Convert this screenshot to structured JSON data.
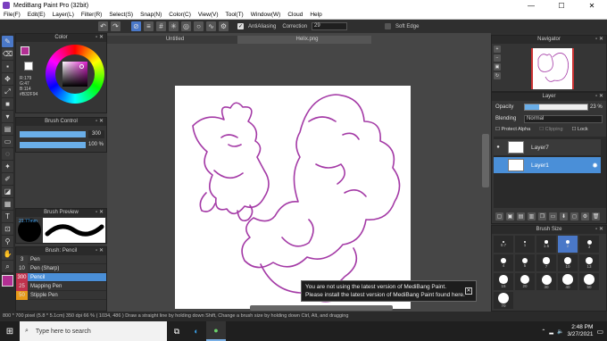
{
  "window": {
    "title": "MediBang Paint Pro (32bit)",
    "minimize": "—",
    "maximize": "☐",
    "close": "✕"
  },
  "menu": [
    "File(F)",
    "Edit(E)",
    "Layer(L)",
    "Filter(R)",
    "Select(S)",
    "Snap(N)",
    "Color(C)",
    "View(V)",
    "Tool(T)",
    "Window(W)",
    "Cloud",
    "Help"
  ],
  "toolbar": {
    "antialiasing_label": "AntiAliasing",
    "correction_label": "Correction",
    "correction_value": "29",
    "soft_edge_label": "Soft Edge"
  },
  "color_panel": {
    "title": "Color",
    "values": [
      "R:179",
      "G:47",
      "B:114",
      "#B32F94"
    ],
    "primary_color": "#b32f94"
  },
  "brush_control": {
    "title": "Brush Control",
    "size_value": "300",
    "opacity_value": "100 %"
  },
  "brush_preview": {
    "title": "Brush Preview",
    "size_label": "21.77mm"
  },
  "brush_list": {
    "title": "Brush: Pencil",
    "items": [
      {
        "size": "3",
        "name": "Pen",
        "color": "#3a3a3a"
      },
      {
        "size": "10",
        "name": "Pen (Sharp)",
        "color": "#3a3a3a"
      },
      {
        "size": "300",
        "name": "Pencil",
        "color": "#c0324d",
        "selected": true
      },
      {
        "size": "25",
        "name": "Mapping Pen",
        "color": "#c0324d"
      },
      {
        "size": "50",
        "name": "Stipple Pen",
        "color": "#e89a1a"
      }
    ]
  },
  "documents": {
    "tabs": [
      "Untitled",
      "Helix.png"
    ]
  },
  "popup": {
    "line1": "You are not using the latest version of MediBang Paint.",
    "line2": "Please install the latest version of MediBang Paint found here.",
    "close": "✕"
  },
  "navigator": {
    "title": "Navigator"
  },
  "layer_panel": {
    "title": "Layer",
    "opacity_label": "Opacity",
    "opacity_value": "23 %",
    "opacity_fraction": 0.23,
    "blending_label": "Blending",
    "blending_value": "Normal",
    "protect_alpha": "Protect Alpha",
    "clipping": "Clipping",
    "lock": "Lock",
    "layers": [
      {
        "name": "Layer7",
        "selected": false
      },
      {
        "name": "Layer1",
        "selected": true
      }
    ]
  },
  "brush_size": {
    "title": "Brush Size",
    "labels": [
      "0.7",
      "1",
      "1.5",
      "2",
      "3",
      "4",
      "5",
      "7",
      "10",
      "13",
      "15",
      "20",
      "30",
      "40",
      "50",
      "70"
    ]
  },
  "statusbar": {
    "text": "800 * 700 pixel  (5.8 * 5.1cm)  350 dpi  66 %  ( 1034, 486 )  Draw a straight line by holding down Shift, Change a brush size by holding down Ctrl, Alt, and dragging"
  },
  "taskbar": {
    "search_placeholder": "Type here to search",
    "time": "2:48 PM",
    "date": "3/27/2021"
  }
}
